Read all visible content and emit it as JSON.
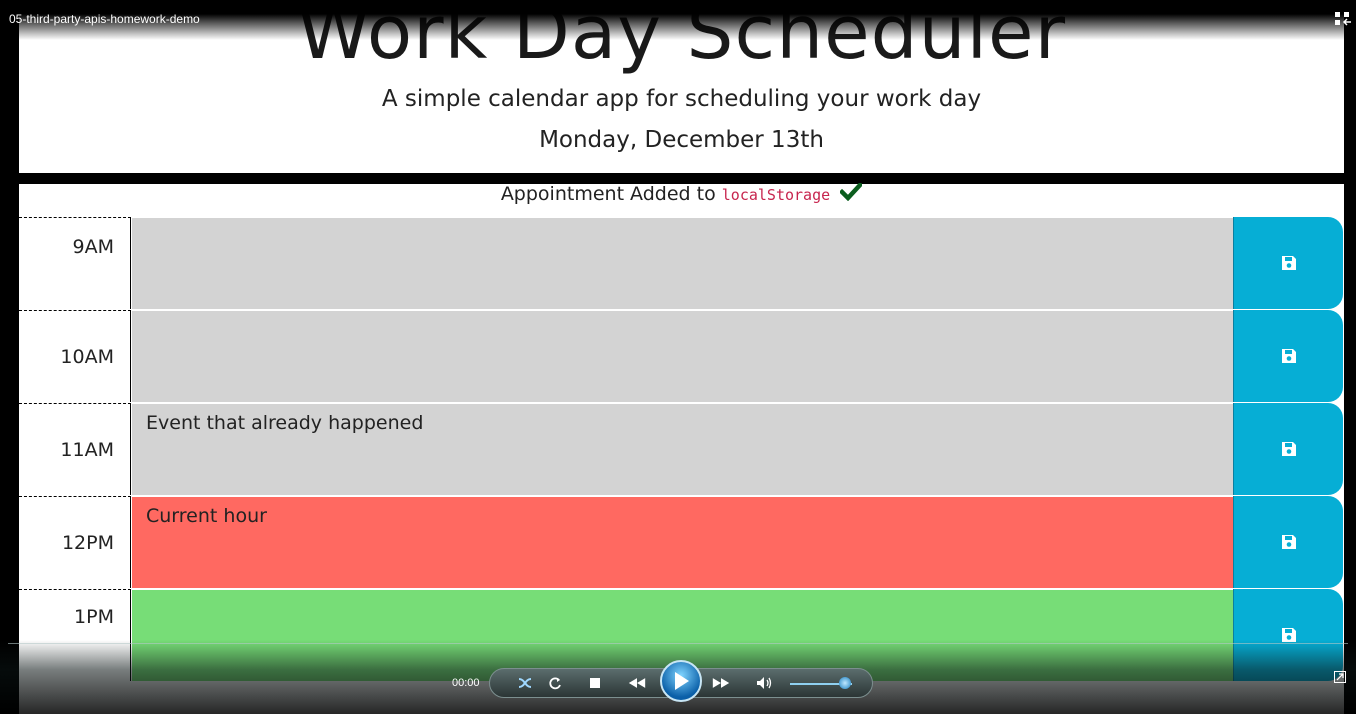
{
  "window": {
    "title": "05-third-party-apis-homework-demo"
  },
  "header": {
    "title": "Work Day Scheduler",
    "lead": "A simple calendar app for scheduling your work day",
    "current_day": "Monday, December 13th"
  },
  "notice": {
    "text": "Appointment Added to",
    "code": "localStorage"
  },
  "rows": [
    {
      "hour": "9AM",
      "text": "",
      "state": "past"
    },
    {
      "hour": "10AM",
      "text": "",
      "state": "past"
    },
    {
      "hour": "11AM",
      "text": "Event that already happened",
      "state": "past"
    },
    {
      "hour": "12PM",
      "text": "Current hour",
      "state": "present"
    },
    {
      "hour": "1PM",
      "text": "",
      "state": "future"
    }
  ],
  "player": {
    "time": "00:00",
    "volume_fraction": 0.8
  },
  "icons": {
    "save": "save-icon",
    "check": "check-icon",
    "fullscreen": "fullscreen-icon",
    "play": "play-icon"
  },
  "colors": {
    "past": "#d3d3d3",
    "present": "#ff6961",
    "future": "#77dd77",
    "save_button": "#06aed5",
    "check": "#0b5d1e",
    "code": "#c7254e"
  }
}
